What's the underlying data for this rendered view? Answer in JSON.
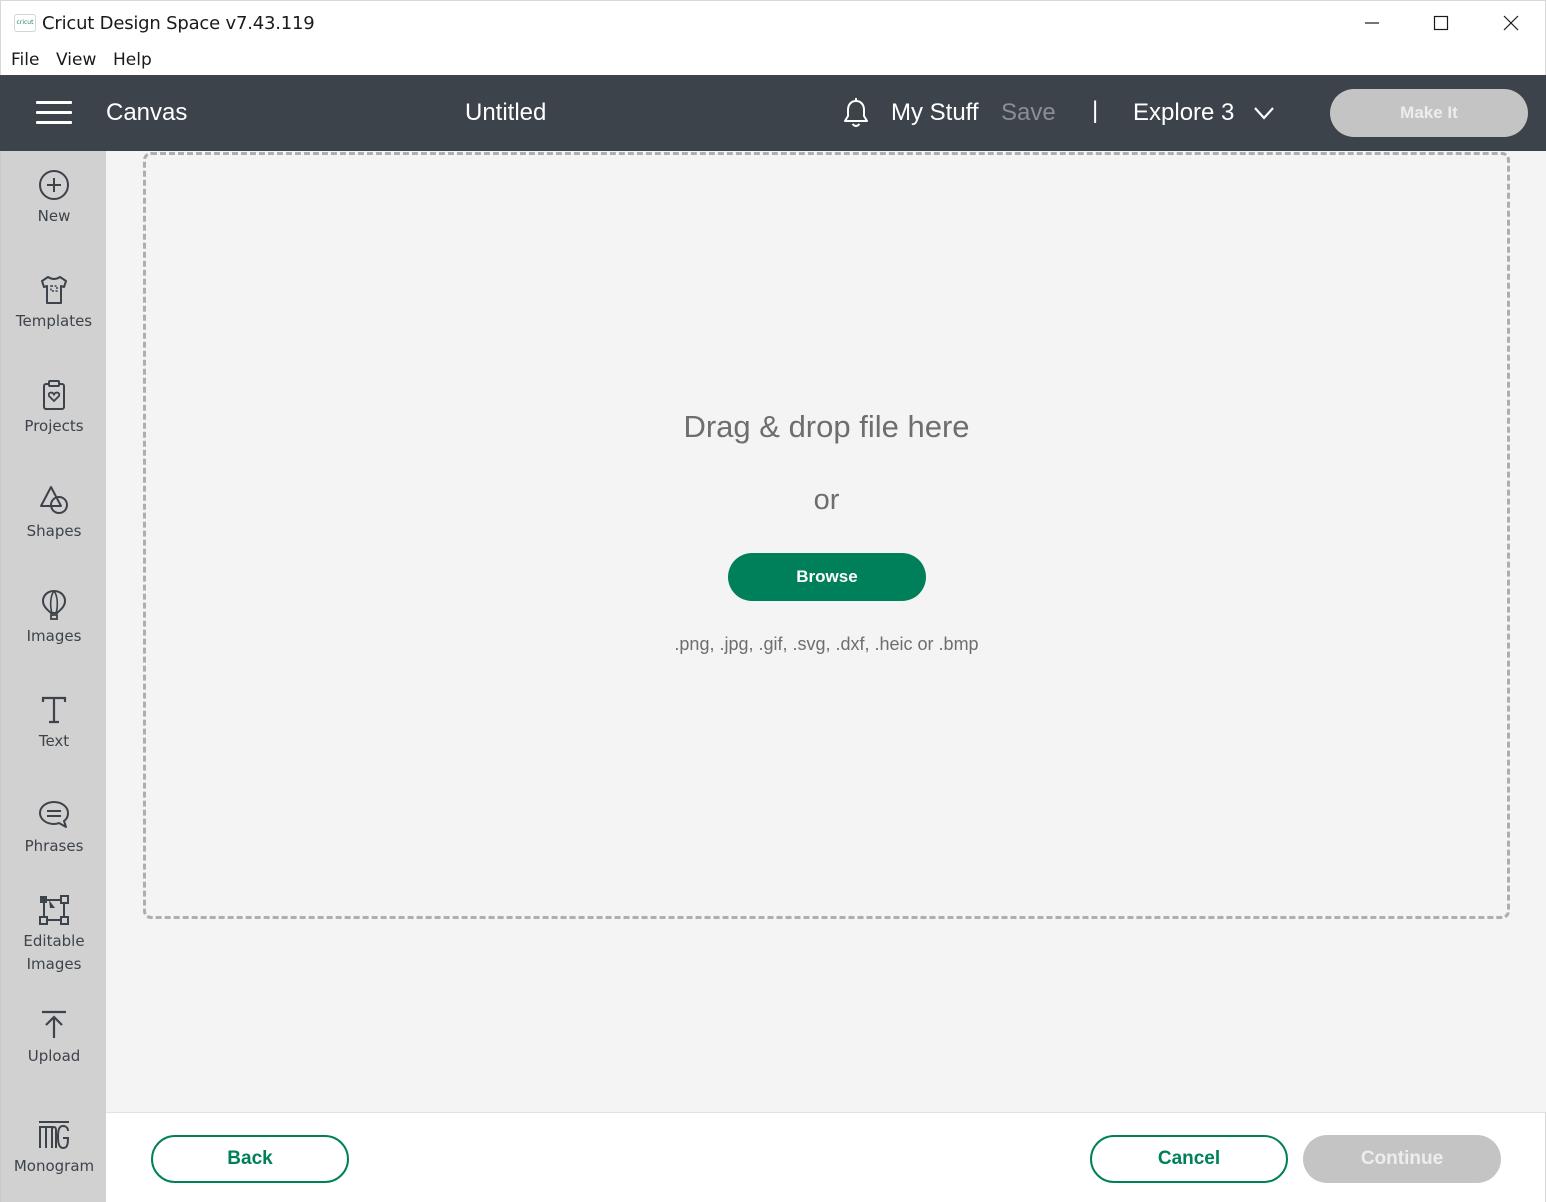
{
  "window": {
    "logo_text": "cricut",
    "title": "Cricut Design Space  v7.43.119"
  },
  "menubar": {
    "items": [
      "File",
      "View",
      "Help"
    ]
  },
  "header": {
    "section": "Canvas",
    "doc_title": "Untitled",
    "my_stuff": "My Stuff",
    "save": "Save",
    "divider": "|",
    "machine": "Explore 3",
    "make_it": "Make It"
  },
  "sidebar": {
    "items": [
      {
        "label": "New",
        "icon": "plus-circle-icon"
      },
      {
        "label": "Templates",
        "icon": "tshirt-icon"
      },
      {
        "label": "Projects",
        "icon": "projects-icon"
      },
      {
        "label": "Shapes",
        "icon": "shapes-icon"
      },
      {
        "label": "Images",
        "icon": "balloon-icon"
      },
      {
        "label": "Text",
        "icon": "text-icon"
      },
      {
        "label": "Phrases",
        "icon": "speech-bubble-icon"
      },
      {
        "label": "Editable",
        "label2": "Images",
        "icon": "editable-images-icon"
      },
      {
        "label": "Upload",
        "icon": "upload-icon"
      },
      {
        "label": "Monogram",
        "icon": "monogram-icon"
      }
    ]
  },
  "upload": {
    "drop_text": "Drag & drop file here",
    "or_text": "or",
    "browse": "Browse",
    "formats": ".png, .jpg, .gif, .svg, .dxf, .heic or .bmp"
  },
  "footer": {
    "back": "Back",
    "cancel": "Cancel",
    "continue": "Continue"
  },
  "colors": {
    "header_bg": "#3d434a",
    "accent_green": "#00805a",
    "disabled_gray": "#c4c4c4",
    "sidebar_bg": "#d1d1d1"
  }
}
